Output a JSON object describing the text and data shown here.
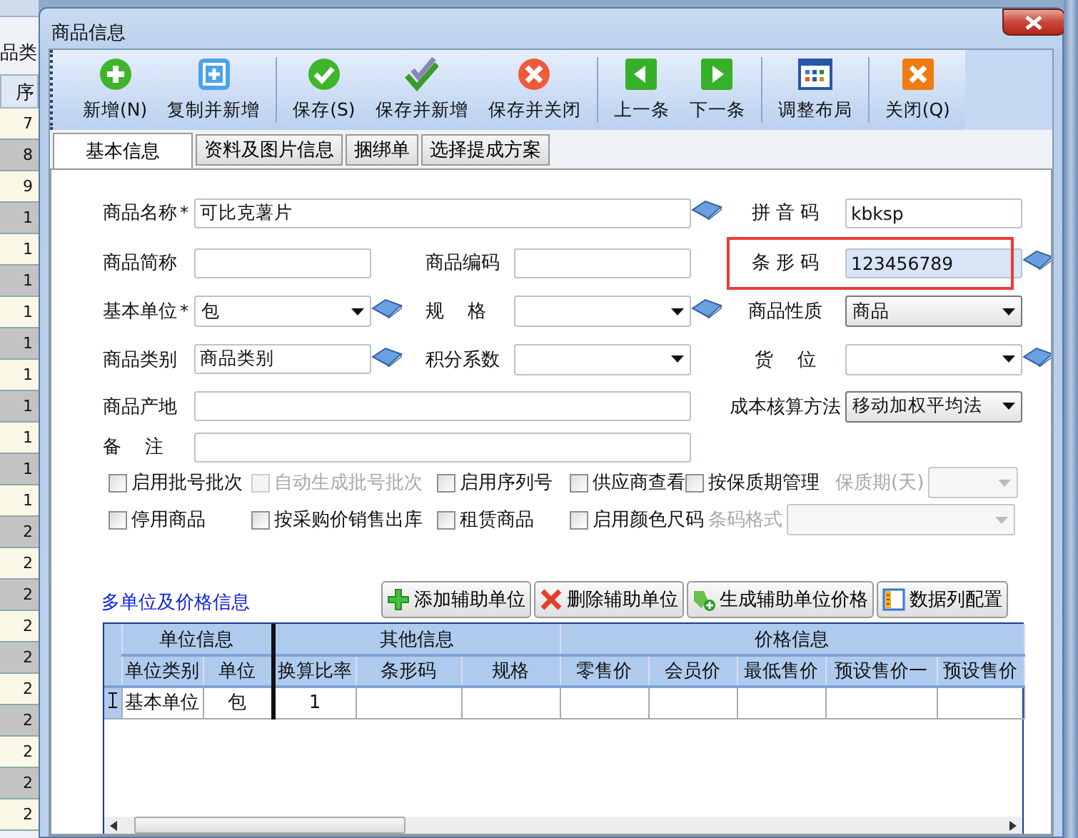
{
  "background_app": {
    "filter_label": "品类",
    "column_header": "序",
    "row_numbers": [
      "7",
      "8",
      "9",
      "1",
      "1",
      "1",
      "1",
      "1",
      "1",
      "1",
      "1",
      "1",
      "1",
      "2",
      "2",
      "2",
      "2",
      "2",
      "2",
      "2",
      "2",
      "2",
      "2"
    ]
  },
  "window": {
    "title": "商品信息"
  },
  "toolbar_groups": [
    [
      {
        "label": "新增(N)"
      },
      {
        "label": "复制并新增"
      }
    ],
    [
      {
        "label": "保存(S)"
      },
      {
        "label": "保存并新增"
      },
      {
        "label": "保存并关闭"
      }
    ],
    [
      {
        "label": "上一条"
      },
      {
        "label": "下一条"
      }
    ],
    [
      {
        "label": "调整布局"
      }
    ],
    [
      {
        "label": "关闭(Q)"
      }
    ]
  ],
  "tabs": [
    {
      "label": "基本信息",
      "selected": true
    },
    {
      "label": "资料及图片信息",
      "selected": false
    },
    {
      "label": "捆绑单",
      "selected": false
    },
    {
      "label": "选择提成方案",
      "selected": false
    }
  ],
  "form_rows": [
    [
      {
        "kind": "wide",
        "label": "商品名称",
        "required_mark": "*",
        "value": "可比克薯片",
        "lookup": true
      },
      {
        "kind": "text",
        "label": "拼 音 码",
        "value": "kbksp"
      }
    ],
    [
      {
        "kind": "text",
        "label": "商品简称"
      },
      {
        "kind": "text",
        "label": "商品编码"
      },
      {
        "kind": "text",
        "label": "条 形 码",
        "value": "123456789",
        "lookup": true,
        "focused": true,
        "marked": true
      }
    ],
    [
      {
        "kind": "combo",
        "label": "基本单位",
        "required_mark": "*",
        "value": "包",
        "lookup": true
      },
      {
        "kind": "combo",
        "label": "规    格",
        "lookup": true
      },
      {
        "kind": "picker",
        "label": "商品性质",
        "value": "商品"
      }
    ],
    [
      {
        "kind": "text",
        "label": "商品类别",
        "value": "商品类别",
        "lookup": true
      },
      {
        "kind": "combo",
        "label": "积分系数"
      },
      {
        "kind": "combo",
        "label": "货    位",
        "lookup": true
      }
    ],
    [
      {
        "kind": "wide",
        "label": "商品产地"
      },
      {
        "kind": "picker",
        "label": "成本核算方法",
        "value": "移动加权平均法"
      }
    ],
    [
      {
        "kind": "wide",
        "label": "备    注"
      }
    ]
  ],
  "option_rows": [
    [
      {
        "kind": "checkbox",
        "label": "启用批号批次",
        "checked": false,
        "disabled": false
      },
      {
        "kind": "checkbox",
        "label": "自动生成批号批次",
        "checked": false,
        "disabled": true
      },
      {
        "kind": "checkbox",
        "label": "启用序列号",
        "checked": false,
        "disabled": false
      },
      {
        "kind": "checkbox",
        "label": "供应商查看",
        "checked": false,
        "disabled": false
      },
      {
        "kind": "checkbox",
        "label": "按保质期管理",
        "checked": false,
        "disabled": false
      },
      {
        "kind": "select",
        "label": "保质期(天)",
        "disabled": true
      }
    ],
    [
      {
        "kind": "checkbox",
        "label": "停用商品",
        "checked": false,
        "disabled": false
      },
      {
        "kind": "checkbox",
        "label": "按采购价销售出库",
        "checked": false,
        "disabled": false
      },
      {
        "kind": "checkbox",
        "label": "租赁商品",
        "checked": false,
        "disabled": false
      },
      {
        "kind": "checkbox",
        "label": "启用颜色尺码",
        "checked": false,
        "disabled": false
      },
      {
        "kind": "select",
        "label": "条码格式",
        "disabled": true
      }
    ]
  ],
  "unit_grid": {
    "title": "多单位及价格信息",
    "buttons": [
      {
        "label": "添加辅助单位"
      },
      {
        "label": "删除辅助单位"
      },
      {
        "label": "生成辅助单位价格"
      },
      {
        "label": "数据列配置"
      }
    ],
    "column_groups": [
      {
        "label": "单位信息",
        "columns": [
          "单位类别",
          "单位"
        ]
      },
      {
        "label": "其他信息",
        "columns": [
          "换算比率",
          "条形码",
          "规格"
        ]
      },
      {
        "label": "价格信息",
        "columns": [
          "零售价",
          "会员价",
          "最低售价",
          "预设售价一",
          "预设售价"
        ]
      }
    ],
    "rows": [
      {
        "editing": true,
        "cells": [
          "基本单位",
          "包",
          "1"
        ]
      }
    ]
  }
}
